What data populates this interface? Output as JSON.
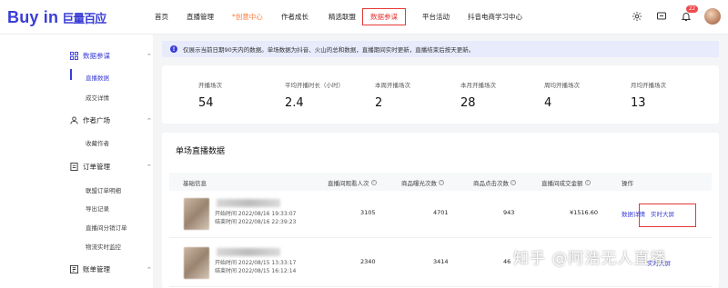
{
  "header": {
    "logo_text": "Buy in",
    "logo_brand": "巨量百应",
    "nav": [
      {
        "label": "首页"
      },
      {
        "label": "直播管理"
      },
      {
        "label": "创意中心",
        "spark": "*"
      },
      {
        "label": "作者成长"
      },
      {
        "label": "精选联盟"
      },
      {
        "label": "数据参谋"
      },
      {
        "label": "平台活动"
      },
      {
        "label": "抖音电商学习中心"
      }
    ],
    "notification_count": "22"
  },
  "sidebar": {
    "groups": [
      {
        "label": "数据参谋",
        "items": [
          "直播数据",
          "成交详情"
        ]
      },
      {
        "label": "作者广场",
        "items": [
          "收藏作者"
        ]
      },
      {
        "label": "订单管理",
        "items": [
          "联盟订单明细",
          "导出记录",
          "直播间分销订单",
          "物流实时监控"
        ]
      },
      {
        "label": "账单管理",
        "items": []
      }
    ]
  },
  "notice": {
    "text": "仅展示当前日期90天内的数据。单场数据为抖音、火山的总和数据，直播期间实时更新，直播结束后按天更新。"
  },
  "stats": [
    {
      "label": "开播场次",
      "value": "54"
    },
    {
      "label": "平均开播时长（小时）",
      "value": "2.4"
    },
    {
      "label": "本周开播场次",
      "value": "2"
    },
    {
      "label": "本月开播场次",
      "value": "28"
    },
    {
      "label": "周均开播场次",
      "value": "4"
    },
    {
      "label": "月均开播场次",
      "value": "13"
    }
  ],
  "table": {
    "title": "单场直播数据",
    "columns": [
      "基础信息",
      "直播间观看人次",
      "商品曝光次数",
      "商品点击次数",
      "直播间成交金额",
      "操作"
    ],
    "rows": [
      {
        "start": "开始时间  2022/08/16 19:33:07",
        "end": "结束时间  2022/08/16 22:39:23",
        "views": "3105",
        "exposure": "4701",
        "clicks": "943",
        "gmv": "¥1516.60",
        "op1": "数据详情",
        "op2": "实时大屏"
      },
      {
        "start": "开始时间  2022/08/15 13:33:17",
        "end": "结束时间  2022/08/15 16:12:14",
        "views": "2340",
        "exposure": "3414",
        "clicks": "46",
        "gmv": "",
        "op1": "",
        "op2": "实时大屏"
      }
    ]
  },
  "watermark": "知乎 @阿浩无人直播"
}
